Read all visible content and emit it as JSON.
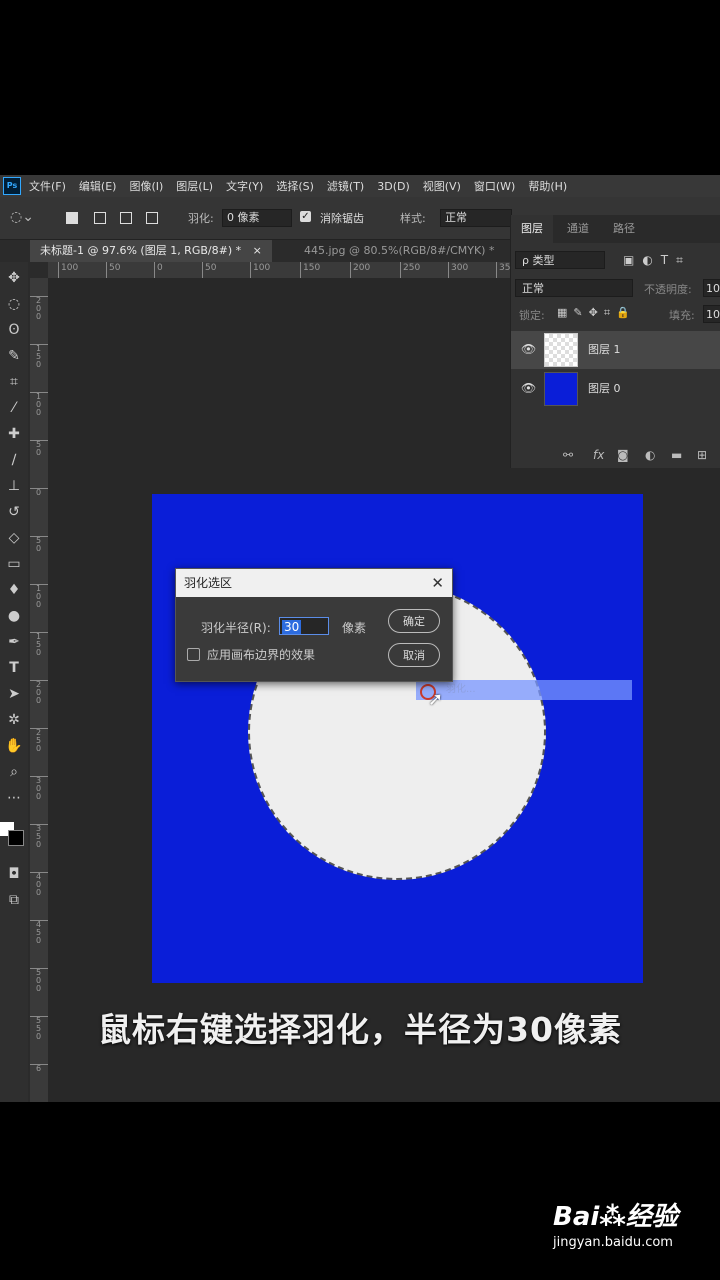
{
  "menu": {
    "logo": "Ps",
    "items": [
      "文件(F)",
      "编辑(E)",
      "图像(I)",
      "图层(L)",
      "文字(Y)",
      "选择(S)",
      "滤镜(T)",
      "3D(D)",
      "视图(V)",
      "窗口(W)",
      "帮助(H)"
    ]
  },
  "options": {
    "feather_label": "羽化:",
    "feather_value": "0 像素",
    "antialias_label": "消除锯齿",
    "style_label": "样式:",
    "style_value": "正常"
  },
  "tabs": [
    {
      "label": "未标题-1 @ 97.6% (图层 1, RGB/8#) *",
      "close": "×"
    },
    {
      "label": "445.jpg @ 80.5%(RGB/8#/CMYK) *"
    }
  ],
  "ruler": {
    "h_ticks": [
      "100",
      "50",
      "0",
      "50",
      "100",
      "150",
      "200",
      "250",
      "300",
      "35"
    ],
    "v_ticks": [
      "2\n0\n0",
      "1\n5\n0",
      "1\n0\n0",
      "5\n0",
      "0",
      "5\n0",
      "1\n0\n0",
      "1\n5\n0",
      "2\n0\n0",
      "2\n5\n0",
      "3\n0\n0",
      "3\n5\n0",
      "4\n0\n0",
      "4\n5\n0",
      "5\n0\n0",
      "5\n5\n0",
      "6"
    ]
  },
  "dialog": {
    "title": "羽化选区",
    "close": "✕",
    "radius_label": "羽化半径(R):",
    "radius_value": "30",
    "unit": "像素",
    "checkbox_label": "应用画布边界的效果",
    "ok": "确定",
    "cancel": "取消"
  },
  "context_hint": "羽化...",
  "layers_panel": {
    "tabs": [
      "图层",
      "通道",
      "路径"
    ],
    "filter": "ρ 类型",
    "blend_mode": "正常",
    "opacity_label": "不透明度:",
    "opacity_value": "10",
    "lock_label": "锁定:",
    "fill_label": "填充:",
    "fill_value": "10",
    "layers": [
      {
        "name": "图层 1",
        "selected": true
      },
      {
        "name": "图层 0",
        "selected": false
      }
    ]
  },
  "colors": {
    "canvas_blue": "#0a1ed8",
    "circle": "#eeeeee",
    "accent": "#2d6cdf"
  },
  "caption": "鼠标右键选择羽化，半径为30像素",
  "watermark": {
    "logo": "Bai⁂经验",
    "url": "jingyan.baidu.com"
  }
}
